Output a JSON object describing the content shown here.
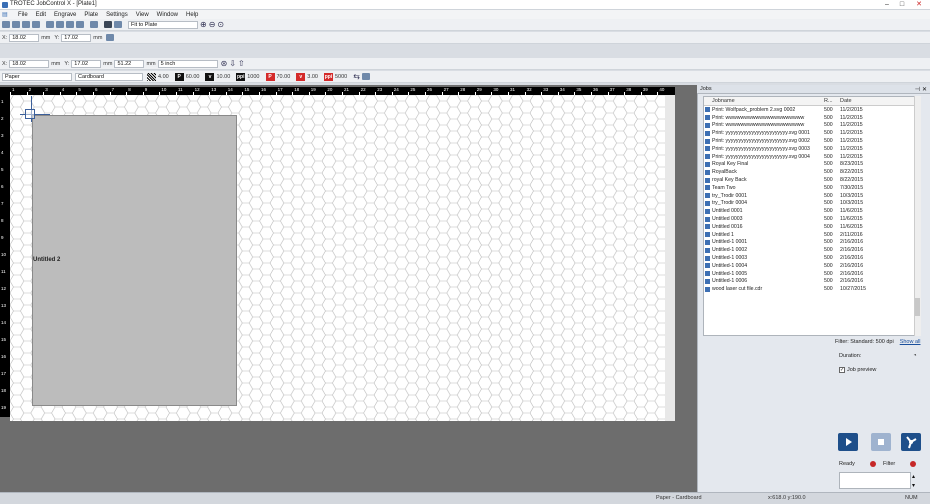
{
  "window": {
    "title": "TROTEC JobControl X - [Plate1]"
  },
  "menu": [
    "File",
    "Edit",
    "Engrave",
    "Plate",
    "Settings",
    "View",
    "Window",
    "Help"
  ],
  "toolbar1": {
    "zoom_option": "Fit to Plate"
  },
  "toolbar2": {
    "x_label": "X:",
    "x_value": "18.02",
    "x_unit": "mm",
    "y_label": "Y:",
    "y_value": "17.02",
    "y_unit": "mm"
  },
  "toolbar3": {
    "x_label": "X:",
    "x_value": "18.02",
    "x_unit": "mm",
    "y_label": "Y:",
    "y_value": "17.02",
    "y_unit": "mm",
    "w_value": "51.22",
    "w_unit": "mm",
    "size_option": "5 inch"
  },
  "toolbar4": {
    "material_group": "Paper",
    "material": "Cardboard",
    "swatches": [
      {
        "name": "raster",
        "color": "#000000",
        "label": "",
        "value": "4.00"
      },
      {
        "name": "power",
        "color": "#111111",
        "label": "P",
        "value": "60.00"
      },
      {
        "name": "velocity",
        "color": "#111111",
        "label": "v",
        "value": "10.00"
      },
      {
        "name": "ppi",
        "color": "#111111",
        "label": "ppi",
        "value": "1000"
      },
      {
        "name": "power-red",
        "color": "#d42a2a",
        "label": "P",
        "value": "70.00"
      },
      {
        "name": "velocity-red",
        "color": "#d42a2a",
        "label": "v",
        "value": "3.00"
      },
      {
        "name": "ppi-red",
        "color": "#d42a2a",
        "label": "ppi",
        "value": "5000"
      }
    ]
  },
  "ruler_top": [
    "1",
    "2",
    "3",
    "4",
    "5",
    "6",
    "7",
    "8",
    "9",
    "10",
    "11",
    "12",
    "13",
    "14",
    "15",
    "16",
    "17",
    "18",
    "19",
    "20",
    "21",
    "22",
    "23",
    "24",
    "25",
    "26",
    "27",
    "28",
    "29",
    "30",
    "31",
    "32",
    "33",
    "34",
    "35",
    "36",
    "37",
    "38",
    "39",
    "40"
  ],
  "ruler_left": [
    "1",
    "2",
    "3",
    "4",
    "5",
    "6",
    "7",
    "8",
    "9",
    "10",
    "11",
    "12",
    "13",
    "14",
    "15",
    "16",
    "17",
    "18",
    "19"
  ],
  "canvas": {
    "plate_label": "Untitled 2"
  },
  "panel": {
    "title": "Jobs",
    "columns": [
      "Jobname",
      "R...",
      "Date"
    ],
    "jobs": [
      [
        "Print: Wolfpack_problem 2.svg 0002",
        "500",
        "11/2/2015"
      ],
      [
        "Print: wwwwwwwwwwwwwwwwwwwww",
        "500",
        "11/2/2015"
      ],
      [
        "Print: wwwwwwwwwwwwwwwwwwwww",
        "500",
        "11/2/2015"
      ],
      [
        "Print: yyyyyyyyyyyyyyyyyyyyyyyy.svg 0001",
        "500",
        "11/2/2015"
      ],
      [
        "Print: yyyyyyyyyyyyyyyyyyyyyyyy.svg 0002",
        "500",
        "11/2/2015"
      ],
      [
        "Print: yyyyyyyyyyyyyyyyyyyyyyyy.svg 0003",
        "500",
        "11/2/2015"
      ],
      [
        "Print: yyyyyyyyyyyyyyyyyyyyyyyy.svg 0004",
        "500",
        "11/2/2015"
      ],
      [
        "Royal Key Final",
        "500",
        "8/23/2015"
      ],
      [
        "RoyalBack",
        "500",
        "8/22/2015"
      ],
      [
        "royal Key Back",
        "500",
        "8/22/2015"
      ],
      [
        "Team Two",
        "500",
        "7/30/2015"
      ],
      [
        "try_Trodir 0001",
        "500",
        "10/3/2015"
      ],
      [
        "try_Trodir 0004",
        "500",
        "10/3/2015"
      ],
      [
        "Untitled 0001",
        "500",
        "11/6/2015"
      ],
      [
        "Untitled 0003",
        "500",
        "11/6/2015"
      ],
      [
        "Untitled 0016",
        "500",
        "11/6/2015"
      ],
      [
        "Untitled 1",
        "500",
        "2/11/2016"
      ],
      [
        "Untitled-1 0001",
        "500",
        "2/16/2016"
      ],
      [
        "Untitled-1 0002",
        "500",
        "2/16/2016"
      ],
      [
        "Untitled-1 0003",
        "500",
        "2/16/2016"
      ],
      [
        "Untitled-1 0004",
        "500",
        "2/16/2016"
      ],
      [
        "Untitled-1 0005",
        "500",
        "2/16/2016"
      ],
      [
        "Untitled-1 0006",
        "500",
        "2/16/2016"
      ],
      [
        "wood laser cut file.cdr",
        "500",
        "10/27/2015"
      ]
    ],
    "filter_text": "Filter: Standard: 500 dpi",
    "show_all": "Show all",
    "duration_label": "Duration:",
    "job_preview_label": "Job preview",
    "ready_label": "Ready",
    "filter_label": "Filter"
  },
  "status": {
    "material": "Paper - Cardboard",
    "coords": "x:618.0 y:190.0",
    "num": "NUM"
  }
}
